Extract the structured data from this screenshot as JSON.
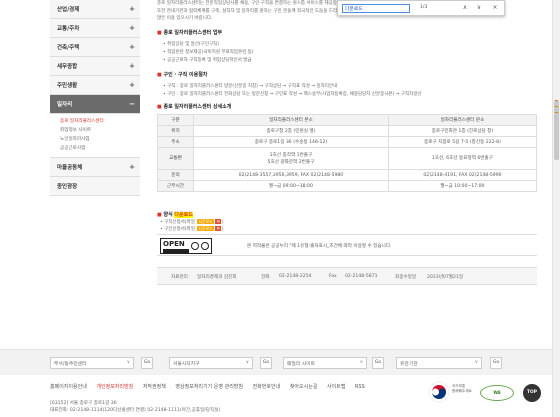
{
  "sidebar": {
    "items": [
      {
        "label": "산업/경제",
        "sign": "+"
      },
      {
        "label": "교통/주차",
        "sign": "+"
      },
      {
        "label": "건축/주택",
        "sign": "+"
      },
      {
        "label": "세무종합",
        "sign": "+"
      },
      {
        "label": "주민생활",
        "sign": "+"
      },
      {
        "label": "일자리",
        "sign": "−"
      }
    ],
    "submenu": [
      "종로 일자리플러스센터",
      "취업정보 사이트",
      "노인일자리사업",
      "공공근로사업"
    ],
    "after": [
      {
        "label": "마을공동체",
        "sign": "+"
      },
      {
        "label": "종인광장",
        "sign": ""
      }
    ]
  },
  "content": {
    "intro1": "종로 일자리플러스센터는 전문직업상담사를 채용, 구인·구직을 연결하는 원스톱 서비스를 제공합니다.",
    "intro2": "또한 관내기관과 협력체계를 구축, 실직자 및 일자리를 원하는 구민 분들께 적극적인 도움을 드리고",
    "intro3": "많은 이용 있으시기 바랍니다.",
    "h1": "종로 일자리플러스센터 업무",
    "list1": [
      "취업상담 및 알선(구인구직)",
      "직업훈련 정보제공(국비지원 무료직업훈련 등)",
      "공공근로자 구직등록 및 취업상담학인서 발급"
    ],
    "h2": "구인 · 구직 이용절차",
    "list2": [
      "구직 : 종로 일자리플러스센터 방문(신분증 지참) ⇒ 구직상담 ⇒ 구직표 작성 ⇒ 일자리안내",
      "구인 : 종로 일자리플러스센터 전화상담 또는 방문신청 ⇒ 구인표 작성 ⇒ 팩스송부(사업자등록증, 채용담당자 신분증사본) ⇒ 구직자알선"
    ],
    "h3": "종로 일자리플러스센터 상세소개",
    "table": {
      "headers": [
        "구분",
        "일자리플러스센터 본소",
        "일자리플러스센터 분소"
      ],
      "rows": [
        [
          "위치",
          "종로구청 2층 (민원실 옆)",
          "종로구민회관 1층 (진로상담 창)"
        ],
        [
          "주소",
          "종로구 종로1길 36 (수송동 146-12)",
          "종로구 지봉로 5길 7-5 (창신동 222-8)"
        ],
        [
          "교통편",
          "1호선 종각역 1번출구\n5호선 광화문역 2번출구",
          "1호선, 6호선 동묘앞역 6번출구"
        ],
        [
          "문의",
          "02)2148-3557,3956,3959, FAX 02)2148-5980",
          "02)2148-4191, FAX 02)2148-5990"
        ],
        [
          "근무시간",
          "월~금 09:00~18:00",
          "월~금 10:00~17:00"
        ]
      ]
    },
    "h4_prefix": "양식",
    "h4_link": "다운로드",
    "forms": [
      {
        "label": "구직신청서(파일",
        "btn": "다운로드"
      },
      {
        "label": "구인신청서(파일",
        "btn": "다운로드"
      }
    ],
    "open_text": "본 저작물은 공공누리 \"제 1유형:출처표시_조건에 따라 이용할 수 있습니다.",
    "meta": {
      "dept_label": "자료관리",
      "dept": "일자리경제과 김진희",
      "phone_label": "전화",
      "phone": "02-2148-2254",
      "fax_label": "Fax",
      "fax": "02-2148-5871",
      "date_label": "최종수정일",
      "date": "2023년07월21일"
    }
  },
  "findbar": {
    "query": "다운로드",
    "count": "1/3",
    "prev": "∧",
    "next": "∨",
    "close": "×"
  },
  "footer": {
    "selects": [
      {
        "label": "부서/동주민센터"
      },
      {
        "label": "서울시자치구"
      },
      {
        "label": "패밀리 사이트"
      },
      {
        "label": "유관기관"
      }
    ],
    "go": "Go",
    "links": [
      "홈페이지이용안내",
      "개인정보처리방침",
      "저작권정책",
      "영상정보처리기기 운영 관리방침",
      "전화번호안내",
      "찾아오시는길",
      "사이트맵",
      "RSS"
    ],
    "address": "[03152] 서울 종로구 종로1길 36",
    "phone_line": "대표전화: 02-2148-1114(120다산콜센터 연결) 02-2148-1111(야간,공휴일/당직실)",
    "badge1": "국가보훈\n함께해주세요",
    "badge2": "WA",
    "top": "TOP"
  },
  "colors": {
    "accent_red": "#d9332e",
    "download_orange": "#f6a800",
    "active_menu": "#6b6b6b"
  }
}
